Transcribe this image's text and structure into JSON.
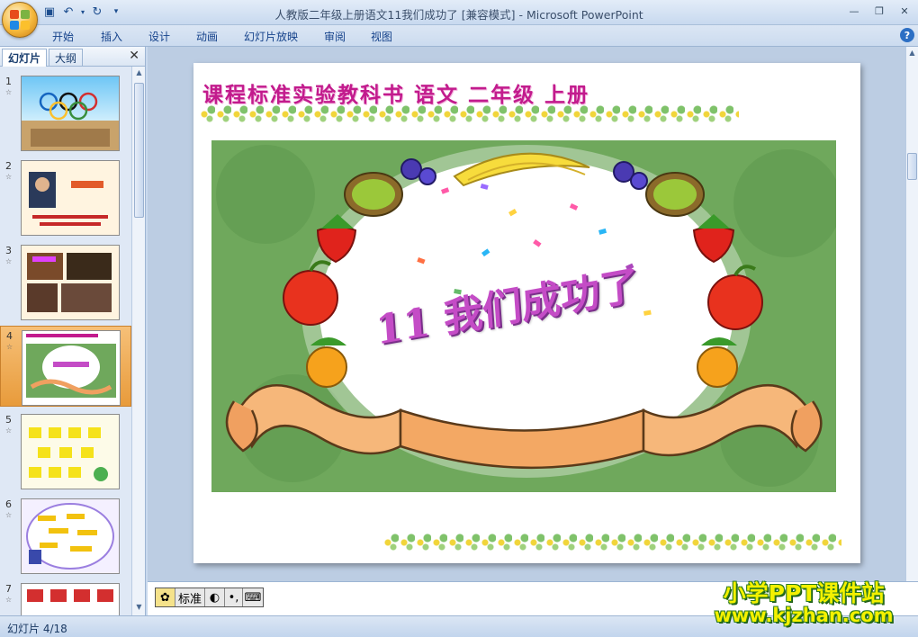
{
  "window": {
    "title": "人教版二年级上册语文11我们成功了 [兼容模式] - Microsoft PowerPoint"
  },
  "ribbon": {
    "tabs": [
      "开始",
      "插入",
      "设计",
      "动画",
      "幻灯片放映",
      "审阅",
      "视图"
    ]
  },
  "left_panel": {
    "tabs": [
      "幻灯片",
      "大纲"
    ],
    "active_tab": "幻灯片",
    "thumbnails": [
      {
        "num": "1"
      },
      {
        "num": "2"
      },
      {
        "num": "3"
      },
      {
        "num": "4",
        "selected": true
      },
      {
        "num": "5"
      },
      {
        "num": "6"
      },
      {
        "num": "7"
      }
    ]
  },
  "slide": {
    "header": "课程标准实验教科书 语文 二年级 上册",
    "title": "11 我们成功了"
  },
  "notes_bar": {
    "ime_mode": "标准"
  },
  "watermark": {
    "line1": "小学PPT课件站",
    "line2": "www.kjzhan.com"
  },
  "status_bar": {
    "slide_position": "幻灯片 4/18"
  },
  "colors": {
    "slide_header": "#c21b8d",
    "slide_title": "#c44cc6",
    "selected_thumb": "#e89b3b",
    "watermark_text": "#f4f100"
  }
}
